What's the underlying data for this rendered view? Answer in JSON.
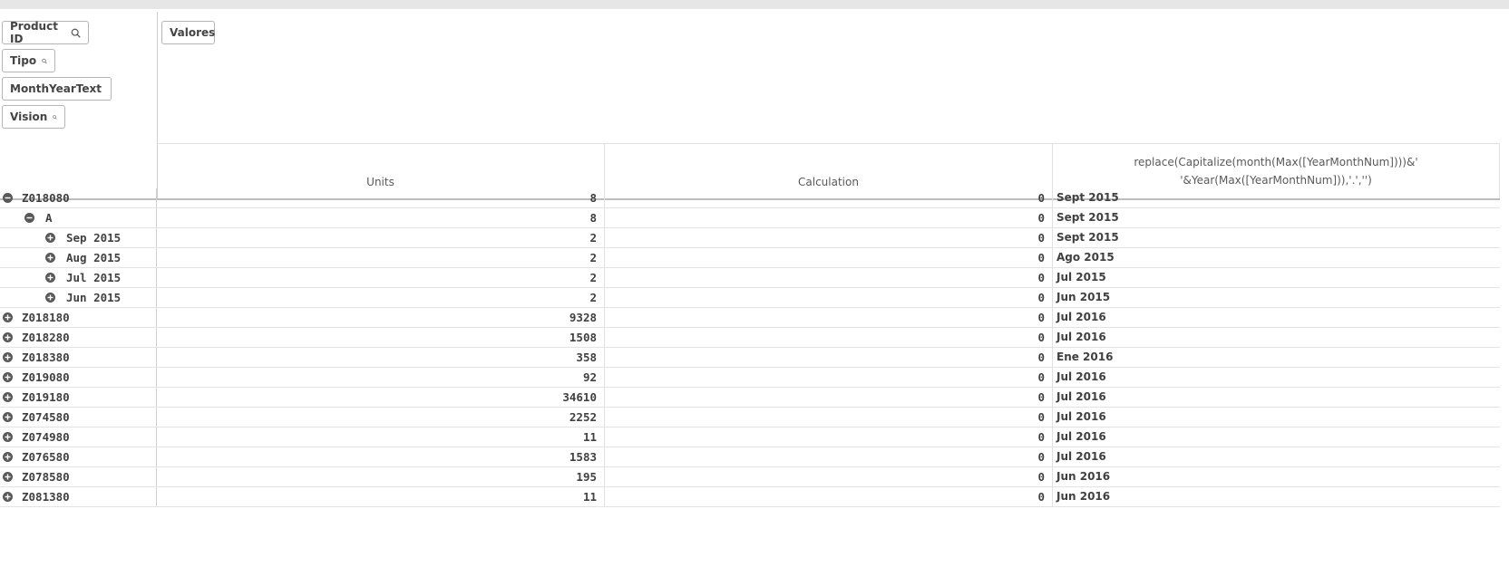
{
  "dimension_chips": [
    "Product ID",
    "Tipo",
    "MonthYearText",
    "Vision"
  ],
  "measure_chip": "Valores",
  "columns": {
    "units": "Units",
    "calculation": "Calculation",
    "expr_line1": "replace(Capitalize(month(Max([YearMonthNum])))&'",
    "expr_line2": "'&Year(Max([YearMonthNum])),'.','')"
  },
  "rows": [
    {
      "label": "Z018080",
      "level": 0,
      "state": "collapse",
      "units": "8",
      "calc": "0",
      "expr": "Sept 2015"
    },
    {
      "label": "A",
      "level": 1,
      "state": "collapse",
      "units": "8",
      "calc": "0",
      "expr": "Sept 2015"
    },
    {
      "label": "Sep 2015",
      "level": 2,
      "state": "expand",
      "units": "2",
      "calc": "0",
      "expr": "Sept 2015"
    },
    {
      "label": "Aug 2015",
      "level": 2,
      "state": "expand",
      "units": "2",
      "calc": "0",
      "expr": "Ago 2015"
    },
    {
      "label": "Jul 2015",
      "level": 2,
      "state": "expand",
      "units": "2",
      "calc": "0",
      "expr": "Jul 2015"
    },
    {
      "label": "Jun 2015",
      "level": 2,
      "state": "expand",
      "units": "2",
      "calc": "0",
      "expr": "Jun 2015"
    },
    {
      "label": "Z018180",
      "level": 0,
      "state": "expand",
      "units": "9328",
      "calc": "0",
      "expr": "Jul 2016"
    },
    {
      "label": "Z018280",
      "level": 0,
      "state": "expand",
      "units": "1508",
      "calc": "0",
      "expr": "Jul 2016"
    },
    {
      "label": "Z018380",
      "level": 0,
      "state": "expand",
      "units": "358",
      "calc": "0",
      "expr": "Ene 2016"
    },
    {
      "label": "Z019080",
      "level": 0,
      "state": "expand",
      "units": "92",
      "calc": "0",
      "expr": "Jul 2016"
    },
    {
      "label": "Z019180",
      "level": 0,
      "state": "expand",
      "units": "34610",
      "calc": "0",
      "expr": "Jul 2016"
    },
    {
      "label": "Z074580",
      "level": 0,
      "state": "expand",
      "units": "2252",
      "calc": "0",
      "expr": "Jul 2016"
    },
    {
      "label": "Z074980",
      "level": 0,
      "state": "expand",
      "units": "11",
      "calc": "0",
      "expr": "Jul 2016"
    },
    {
      "label": "Z076580",
      "level": 0,
      "state": "expand",
      "units": "1583",
      "calc": "0",
      "expr": "Jul 2016"
    },
    {
      "label": "Z078580",
      "level": 0,
      "state": "expand",
      "units": "195",
      "calc": "0",
      "expr": "Jun 2016"
    },
    {
      "label": "Z081380",
      "level": 0,
      "state": "expand",
      "units": "11",
      "calc": "0",
      "expr": "Jun 2016"
    }
  ]
}
